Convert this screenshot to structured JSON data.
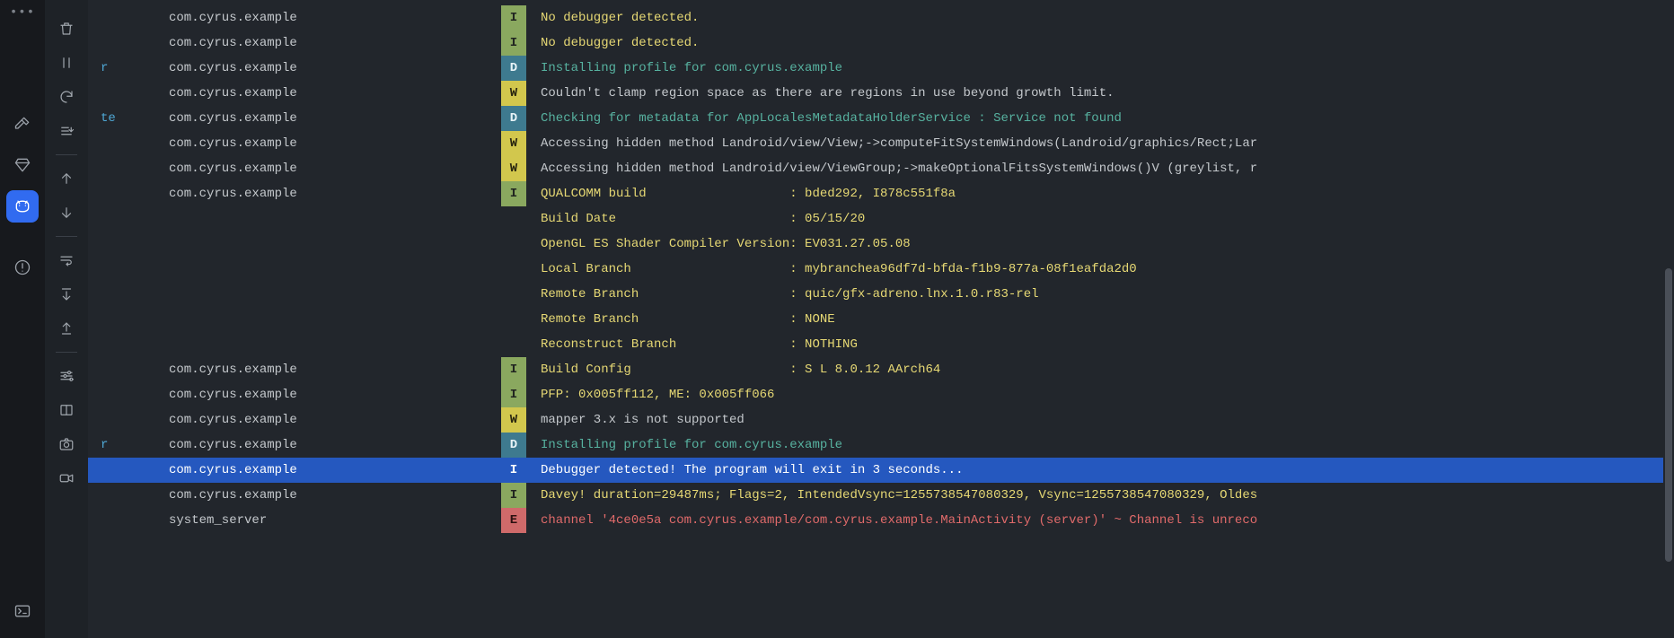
{
  "activity": {
    "dots": "•••",
    "hammer": "hammer",
    "diamond": "diamond",
    "cat": "cat",
    "warning": "warning",
    "terminal": "terminal"
  },
  "tools": {
    "trash": "trash",
    "pause": "pause",
    "refresh": "refresh",
    "download": "download",
    "arrow_up": "arrow-up",
    "arrow_down": "arrow-down",
    "wrap": "wrap",
    "import_down": "import-down",
    "export_up": "export-up",
    "settings": "settings",
    "split": "split",
    "camera": "camera",
    "video": "video"
  },
  "log_rows": [
    {
      "prefix": "",
      "pkg": "com.cyrus.example",
      "level": "I",
      "msg": "No debugger detected."
    },
    {
      "prefix": "",
      "pkg": "com.cyrus.example",
      "level": "I",
      "msg": "No debugger detected."
    },
    {
      "prefix": "r",
      "pkg": "com.cyrus.example",
      "level": "D",
      "msg": "Installing profile for com.cyrus.example"
    },
    {
      "prefix": "",
      "pkg": "com.cyrus.example",
      "level": "W",
      "msg": "Couldn't clamp region space as there are regions in use beyond growth limit."
    },
    {
      "prefix": "te",
      "pkg": "com.cyrus.example",
      "level": "D",
      "msg": "Checking for metadata for AppLocalesMetadataHolderService : Service not found"
    },
    {
      "prefix": "",
      "pkg": "com.cyrus.example",
      "level": "W",
      "msg": "Accessing hidden method Landroid/view/View;->computeFitSystemWindows(Landroid/graphics/Rect;Lar"
    },
    {
      "prefix": "",
      "pkg": "com.cyrus.example",
      "level": "W",
      "msg": "Accessing hidden method Landroid/view/ViewGroup;->makeOptionalFitsSystemWindows()V (greylist, r"
    },
    {
      "prefix": "",
      "pkg": "com.cyrus.example",
      "level": "I",
      "msg": "QUALCOMM build                   : bded292, I878c551f8a"
    },
    {
      "prefix": "",
      "pkg": "",
      "level": "",
      "msg": "Build Date                       : 05/15/20",
      "msg_class": "I"
    },
    {
      "prefix": "",
      "pkg": "",
      "level": "",
      "msg": "OpenGL ES Shader Compiler Version: EV031.27.05.08",
      "msg_class": "I"
    },
    {
      "prefix": "",
      "pkg": "",
      "level": "",
      "msg": "Local Branch                     : mybranchea96df7d-bfda-f1b9-877a-08f1eafda2d0",
      "msg_class": "I"
    },
    {
      "prefix": "",
      "pkg": "",
      "level": "",
      "msg": "Remote Branch                    : quic/gfx-adreno.lnx.1.0.r83-rel",
      "msg_class": "I"
    },
    {
      "prefix": "",
      "pkg": "",
      "level": "",
      "msg": "Remote Branch                    : NONE",
      "msg_class": "I"
    },
    {
      "prefix": "",
      "pkg": "",
      "level": "",
      "msg": "Reconstruct Branch               : NOTHING",
      "msg_class": "I"
    },
    {
      "prefix": "",
      "pkg": "com.cyrus.example",
      "level": "I",
      "msg": "Build Config                     : S L 8.0.12 AArch64"
    },
    {
      "prefix": "",
      "pkg": "com.cyrus.example",
      "level": "I",
      "msg": "PFP: 0x005ff112, ME: 0x005ff066"
    },
    {
      "prefix": "",
      "pkg": "com.cyrus.example",
      "level": "W",
      "msg": "mapper 3.x is not supported"
    },
    {
      "prefix": "r",
      "pkg": "com.cyrus.example",
      "level": "D",
      "msg": "Installing profile for com.cyrus.example"
    },
    {
      "prefix": "",
      "pkg": "com.cyrus.example",
      "level": "I",
      "msg": "Debugger detected! The program will exit in 3 seconds...",
      "selected": true
    },
    {
      "prefix": "",
      "pkg": "com.cyrus.example",
      "level": "I",
      "msg": "Davey! duration=29487ms; Flags=2, IntendedVsync=1255738547080329, Vsync=1255738547080329, Oldes"
    },
    {
      "prefix": "",
      "pkg": "system_server",
      "level": "E",
      "msg": "channel '4ce0e5a com.cyrus.example/com.cyrus.example.MainActivity (server)' ~ Channel is unreco"
    }
  ],
  "scrollbar": {
    "start_pct": 42,
    "height_pct": 46
  }
}
